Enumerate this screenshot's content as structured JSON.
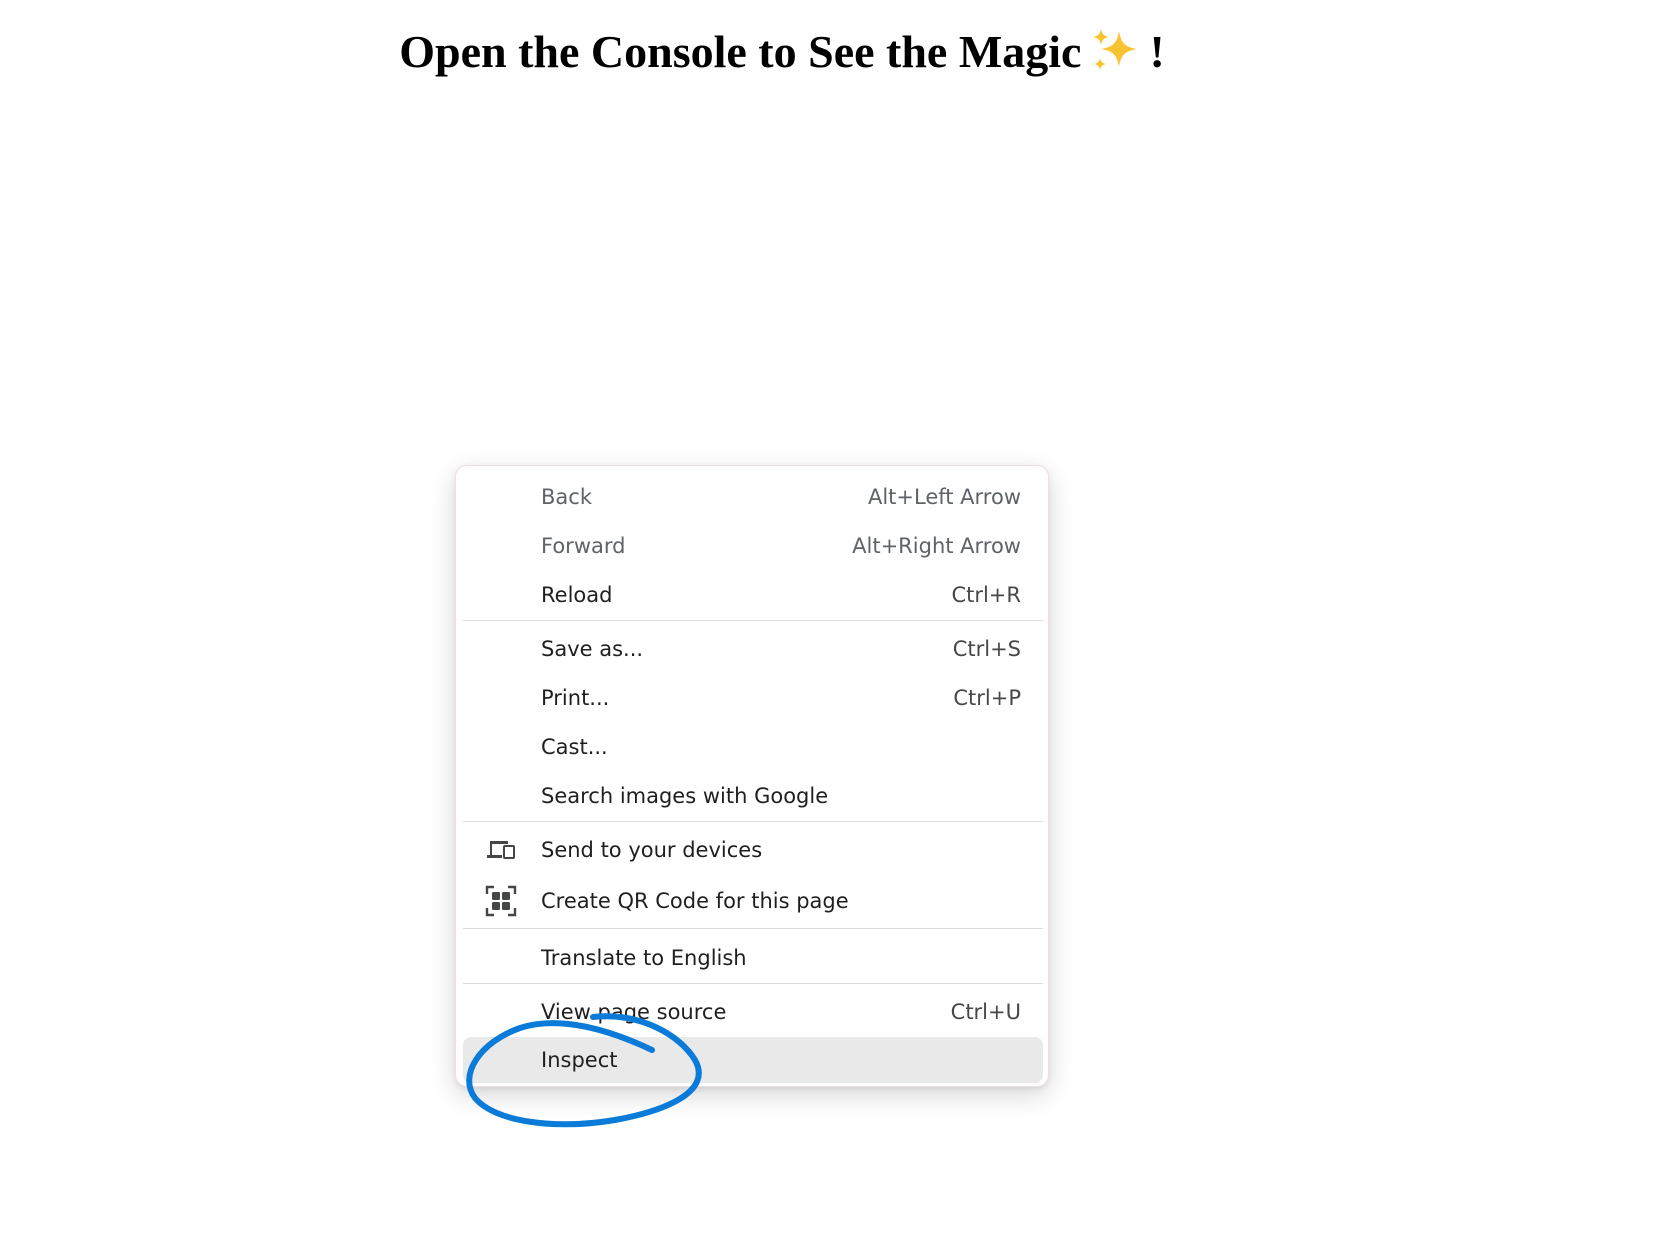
{
  "page": {
    "heading": "Open the Console to See the Magic",
    "heading_emoji": "sparkles-icon",
    "heading_suffix": "!"
  },
  "context_menu": {
    "items": [
      {
        "label": "Back",
        "shortcut": "Alt+Left Arrow",
        "state": "disabled"
      },
      {
        "label": "Forward",
        "shortcut": "Alt+Right Arrow",
        "state": "disabled"
      },
      {
        "label": "Reload",
        "shortcut": "Ctrl+R",
        "state": "enabled"
      },
      {
        "label": "Save as...",
        "shortcut": "Ctrl+S",
        "state": "enabled"
      },
      {
        "label": "Print...",
        "shortcut": "Ctrl+P",
        "state": "enabled"
      },
      {
        "label": "Cast...",
        "shortcut": "",
        "state": "enabled"
      },
      {
        "label": "Search images with Google",
        "shortcut": "",
        "state": "enabled"
      },
      {
        "label": "Send to your devices",
        "shortcut": "",
        "state": "enabled",
        "icon": "devices-icon"
      },
      {
        "label": "Create QR Code for this page",
        "shortcut": "",
        "state": "enabled",
        "icon": "qr-code-icon"
      },
      {
        "label": "Translate to English",
        "shortcut": "",
        "state": "enabled"
      },
      {
        "label": "View page source",
        "shortcut": "Ctrl+U",
        "state": "enabled"
      },
      {
        "label": "Inspect",
        "shortcut": "",
        "state": "highlighted"
      }
    ]
  },
  "annotation": {
    "type": "hand-drawn circle around Inspect",
    "color": "#0a7bd8"
  },
  "colors": {
    "menu_text": "#1f1f1f",
    "disabled_text": "#5f6368",
    "hover_background": "#e9e9ea",
    "separator": "#dadce0",
    "sparkle": "#f7c331"
  }
}
